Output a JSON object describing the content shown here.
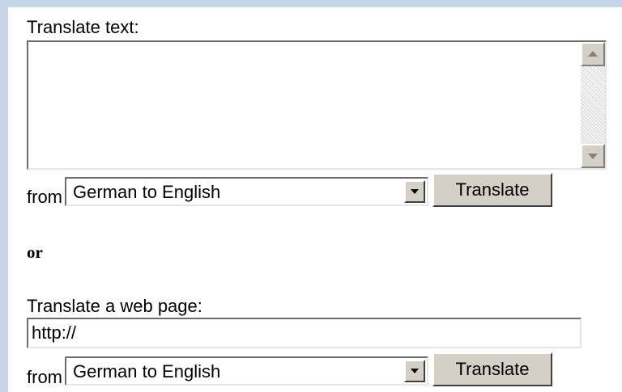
{
  "text_section": {
    "label": "Translate text:",
    "from_label": "from",
    "language_selected": "German to English",
    "button_label": "Translate"
  },
  "separator": "or",
  "web_section": {
    "label": "Translate a web page:",
    "url_value": "http://",
    "from_label": "from",
    "language_selected": "German to English",
    "button_label": "Translate"
  }
}
